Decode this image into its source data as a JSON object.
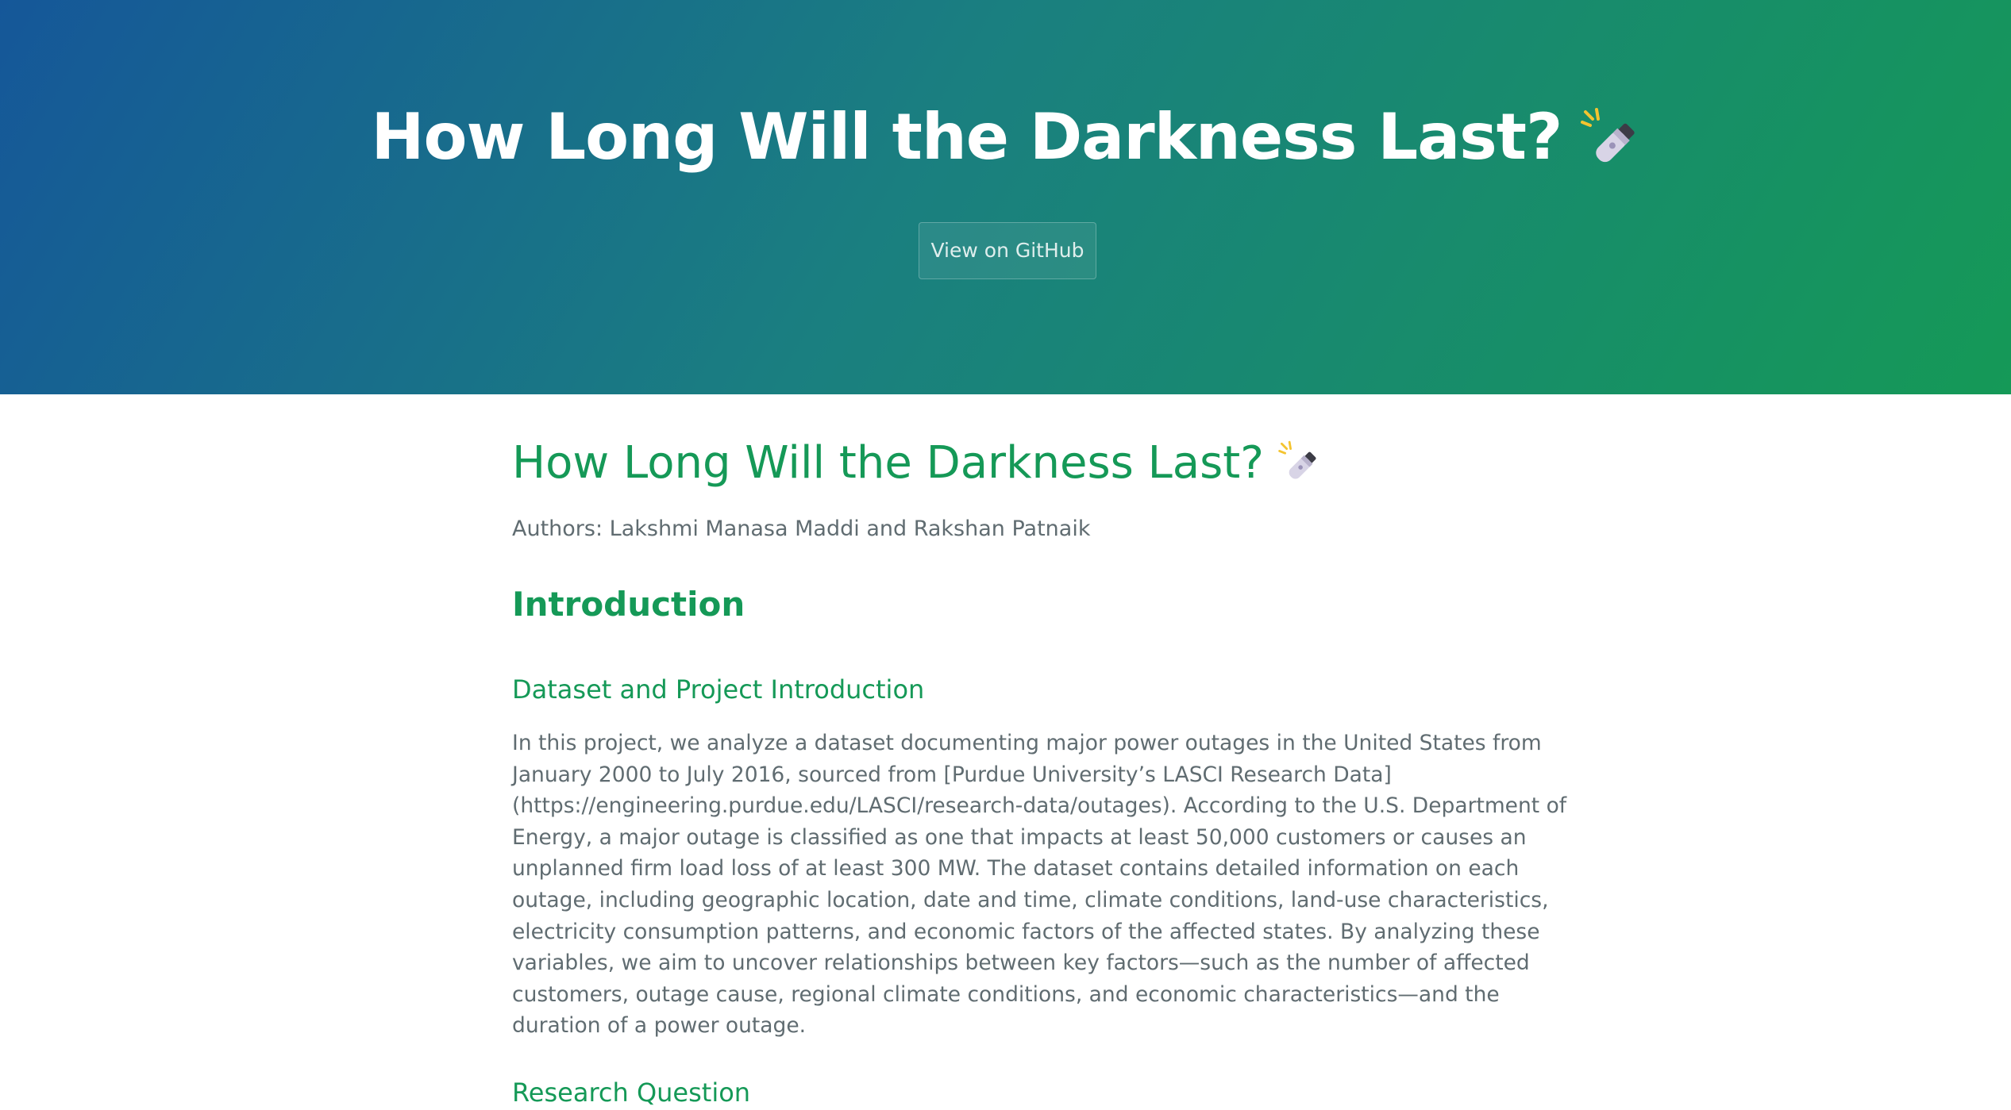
{
  "hero": {
    "title": "How Long Will the Darkness Last?",
    "title_icon": "flashlight-icon",
    "github_button": "View on GitHub"
  },
  "main": {
    "title": "How Long Will the Darkness Last?",
    "title_icon": "flashlight-icon",
    "authors": "Authors: Lakshmi Manasa Maddi and Rakshan Patnaik",
    "section_intro": "Introduction",
    "subsection_dataset": "Dataset and Project Introduction",
    "paragraph_lines": [
      "In this project, we analyze a dataset documenting major power outages in the United States from",
      "January 2000 to July 2016, sourced from [Purdue University’s LASCI Research Data]",
      "(https://engineering.purdue.edu/LASCI/research-data/outages). According to the U.S. Department of",
      "Energy, a major outage is classified as one that impacts at least 50,000 customers or causes an",
      "unplanned firm load loss of at least 300 MW. The dataset contains detailed information on each",
      "outage, including geographic location, date and time, climate conditions, land-use characteristics,",
      "electricity consumption patterns, and economic factors of the affected states. By analyzing these",
      "variables, we aim to uncover relationships between key factors—such as the number of affected",
      "customers, outage cause, regional climate conditions, and economic characteristics—and the",
      "duration of a power outage."
    ],
    "subsection_research": "Research Question"
  },
  "colors": {
    "gradient_start": "#155799",
    "gradient_end": "#159957",
    "heading": "#159957",
    "body_text": "#606c71"
  }
}
